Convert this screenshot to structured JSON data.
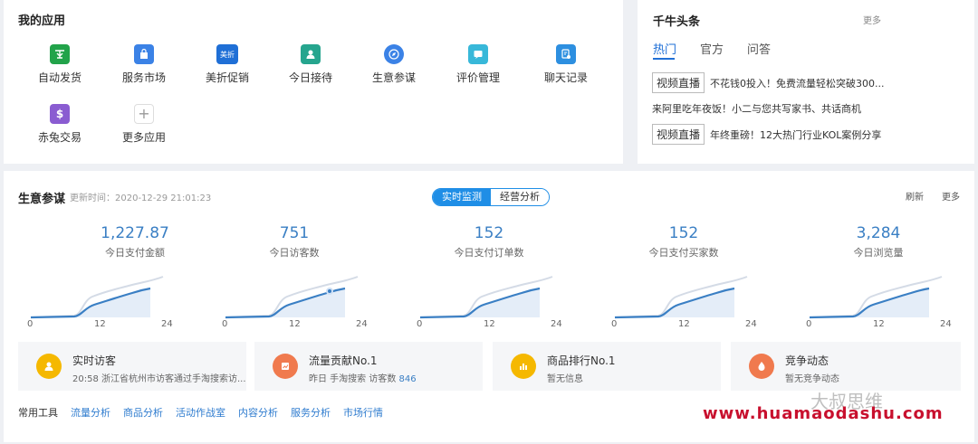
{
  "apps": {
    "title": "我的应用",
    "items": [
      {
        "label": "自动发货",
        "icon": "auto-ship-icon",
        "color": "#22a34a"
      },
      {
        "label": "服务市场",
        "icon": "shopping-bag-icon",
        "color": "#3b82e6"
      },
      {
        "label": "美折促销",
        "icon": "meizhe-logo-icon",
        "color": "#1f6fd6",
        "badge": "美折"
      },
      {
        "label": "今日接待",
        "icon": "customer-service-icon",
        "color": "#26a58e"
      },
      {
        "label": "生意参谋",
        "icon": "compass-icon",
        "color": "#3b82e6"
      },
      {
        "label": "评价管理",
        "icon": "review-icon",
        "color": "#38b8d9"
      },
      {
        "label": "聊天记录",
        "icon": "chat-record-icon",
        "color": "#2d8fe0"
      },
      {
        "label": "赤兔交易",
        "icon": "money-bag-icon",
        "color": "#8a5cd1"
      },
      {
        "label": "更多应用",
        "icon": "plus-icon",
        "color": "#ffffff"
      }
    ]
  },
  "news": {
    "title": "千牛头条",
    "more": "更多",
    "tabs": [
      "热门",
      "官方",
      "问答"
    ],
    "items": [
      {
        "tag": "视频直播",
        "text": "不花钱0投入！免费流量轻松突破300..."
      },
      {
        "tag": "",
        "text": "来阿里吃年夜饭！小二与您共写家书、共话商机"
      },
      {
        "tag": "视频直播",
        "text": "年终重磅！12大热门行业KOL案例分享"
      }
    ]
  },
  "business": {
    "title": "生意参谋",
    "updated": "更新时间：2020-12-29 21:01:23",
    "seg_realtime": "实时监测",
    "seg_analysis": "经营分析",
    "refresh": "刷新",
    "more": "更多",
    "accent": "#1f8ee6",
    "metrics": [
      {
        "value": "1,227.87",
        "label": "今日支付金额"
      },
      {
        "value": "751",
        "label": "今日访客数"
      },
      {
        "value": "152",
        "label": "今日支付订单数"
      },
      {
        "value": "152",
        "label": "今日支付买家数"
      },
      {
        "value": "3,284",
        "label": "今日浏览量"
      }
    ],
    "axis_ticks": [
      "0",
      "12",
      "24"
    ],
    "cards": [
      {
        "title": "实时访客",
        "sub": "20:58 浙江省杭州市访客通过手淘搜索访...",
        "sub_highlight": "",
        "icon": "user-icon",
        "color": "#f5b800"
      },
      {
        "title": "流量贡献No.1",
        "sub": "昨日 手淘搜索 访客数 ",
        "sub_highlight": "846",
        "icon": "trend-chart-icon",
        "color": "#f07a4e"
      },
      {
        "title": "商品排行No.1",
        "sub": "暂无信息",
        "sub_highlight": "",
        "icon": "bar-chart-icon",
        "color": "#f5b800"
      },
      {
        "title": "竞争动态",
        "sub": "暂无竞争动态",
        "sub_highlight": "",
        "icon": "flame-icon",
        "color": "#f07a4e"
      }
    ],
    "tools_label": "常用工具",
    "tools": [
      "流量分析",
      "商品分析",
      "活动作战室",
      "内容分析",
      "服务分析",
      "市场行情"
    ]
  },
  "watermark": {
    "text": "大叔思维",
    "url": "www.huamaodashu.com"
  }
}
